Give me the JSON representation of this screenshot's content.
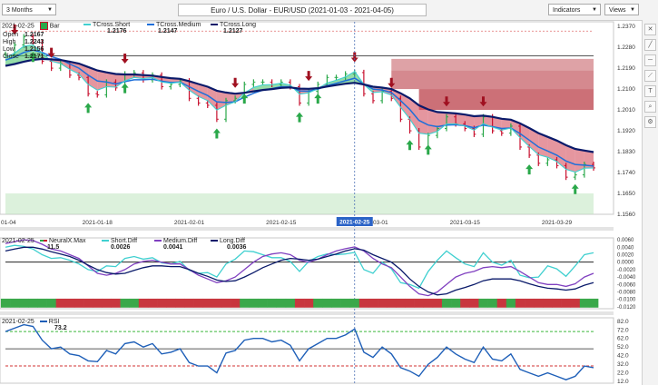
{
  "toolbar": {
    "period": "3 Months",
    "title": "Euro / U.S. Dollar - EUR/USD (2021-01-03 - 2021-04-05)",
    "indicators_label": "Indicators",
    "views_label": "Views"
  },
  "price_legend": {
    "date": "2021-02-25",
    "bar_label": "Bar",
    "open_label": "Open",
    "open": "1.2167",
    "high_label": "High",
    "high": "1.2243",
    "low_label": "Low",
    "low": "1.2156",
    "close_label": "Close",
    "close": "1.2171",
    "short_label": "TCross.Short",
    "short": "1.2176",
    "medium_label": "TCross.Medium",
    "medium": "1.2147",
    "long_label": "TCross.Long",
    "long": "1.2127"
  },
  "diff_legend": {
    "date": "2021-02-25",
    "neural_label": "NeuralX.Max",
    "neural": "11.5",
    "short_label": "Short.Diff",
    "short": "0.0026",
    "medium_label": "Medium.Diff",
    "medium": "0.0041",
    "long_label": "Long.Diff",
    "long": "0.0036"
  },
  "rsi_legend": {
    "date": "2021-02-25",
    "label": "RSI",
    "value": "73.2"
  },
  "x_axis": {
    "labels": [
      "01-04",
      "2021-01-18",
      "2021-02-01",
      "2021-02-15",
      "2021-03-01",
      "2021-03-15",
      "2021-03-29"
    ],
    "cursor_label": "2021-02-25"
  },
  "price_axis": [
    "1.2370",
    "1.2280",
    "1.2190",
    "1.2100",
    "1.2010",
    "1.1920",
    "1.1830",
    "1.1740",
    "1.1650",
    "1.1560"
  ],
  "diff_axis": [
    "0.0060",
    "0.0040",
    "0.0020",
    "0.0000",
    "-0.0020",
    "-0.0040",
    "-0.0060",
    "-0.0080",
    "-0.0100",
    "-0.0120"
  ],
  "rsi_axis": [
    "82.0",
    "72.0",
    "62.0",
    "52.0",
    "42.0",
    "32.0",
    "22.0",
    "12.0"
  ],
  "colors": {
    "short": "#40d0d0",
    "medium": "#8040c0",
    "long": "#0a1a6a",
    "tcross_blue": "#1e6fd9",
    "up": "#2aa84a",
    "down": "#c8102e",
    "rsi": "#1e5fb8",
    "zone": "#b5303a",
    "green_zone": "#bfe6bf"
  },
  "chart_data": {
    "type": "line",
    "dates": [
      "2021-01-04",
      "2021-01-05",
      "2021-01-06",
      "2021-01-07",
      "2021-01-08",
      "2021-01-11",
      "2021-01-12",
      "2021-01-13",
      "2021-01-14",
      "2021-01-15",
      "2021-01-18",
      "2021-01-19",
      "2021-01-20",
      "2021-01-21",
      "2021-01-22",
      "2021-01-25",
      "2021-01-26",
      "2021-01-27",
      "2021-01-28",
      "2021-01-29",
      "2021-02-01",
      "2021-02-02",
      "2021-02-03",
      "2021-02-04",
      "2021-02-05",
      "2021-02-08",
      "2021-02-09",
      "2021-02-10",
      "2021-02-11",
      "2021-02-12",
      "2021-02-15",
      "2021-02-16",
      "2021-02-17",
      "2021-02-18",
      "2021-02-19",
      "2021-02-22",
      "2021-02-23",
      "2021-02-24",
      "2021-02-25",
      "2021-02-26",
      "2021-03-01",
      "2021-03-02",
      "2021-03-03",
      "2021-03-04",
      "2021-03-05",
      "2021-03-08",
      "2021-03-09",
      "2021-03-10",
      "2021-03-11",
      "2021-03-12",
      "2021-03-15",
      "2021-03-16",
      "2021-03-17",
      "2021-03-18",
      "2021-03-19",
      "2021-03-22",
      "2021-03-23",
      "2021-03-24",
      "2021-03-25",
      "2021-03-26",
      "2021-03-29",
      "2021-03-30",
      "2021-03-31",
      "2021-04-01",
      "2021-04-02"
    ],
    "close": [
      1.225,
      1.229,
      1.2325,
      1.23,
      1.222,
      1.219,
      1.221,
      1.216,
      1.215,
      1.208,
      1.2075,
      1.213,
      1.2105,
      1.2165,
      1.217,
      1.214,
      1.216,
      1.211,
      1.212,
      1.2135,
      1.206,
      1.204,
      1.203,
      1.197,
      1.205,
      1.206,
      1.212,
      1.213,
      1.213,
      1.212,
      1.213,
      1.211,
      1.204,
      1.209,
      1.212,
      1.215,
      1.215,
      1.2165,
      1.2171,
      1.208,
      1.205,
      1.209,
      1.206,
      1.197,
      1.192,
      1.185,
      1.19,
      1.193,
      1.198,
      1.195,
      1.193,
      1.1905,
      1.198,
      1.192,
      1.191,
      1.194,
      1.185,
      1.1815,
      1.178,
      1.1795,
      1.177,
      1.172,
      1.173,
      1.1775,
      1.176
    ],
    "short_series": [
      1.2235,
      1.2255,
      1.2285,
      1.229,
      1.2255,
      1.222,
      1.221,
      1.2185,
      1.2165,
      1.212,
      1.2095,
      1.211,
      1.2108,
      1.2135,
      1.215,
      1.2145,
      1.215,
      1.213,
      1.2125,
      1.213,
      1.2095,
      1.2068,
      1.205,
      1.201,
      1.203,
      1.2045,
      1.2083,
      1.2107,
      1.2118,
      1.2119,
      1.2125,
      1.2117,
      1.2078,
      1.2084,
      1.2102,
      1.2126,
      1.2138,
      1.2152,
      1.2176,
      1.212,
      1.2085,
      1.2088,
      1.2074,
      1.2022,
      1.1971,
      1.191,
      1.1905,
      1.1918,
      1.1949,
      1.195,
      1.194,
      1.1923,
      1.1951,
      1.1936,
      1.1923,
      1.1932,
      1.1891,
      1.1853,
      1.1817,
      1.1806,
      1.1788,
      1.1754,
      1.1742,
      1.1759,
      1.176
    ],
    "medium_series": [
      1.2225,
      1.2238,
      1.2258,
      1.2268,
      1.2258,
      1.224,
      1.2228,
      1.2208,
      1.219,
      1.216,
      1.2135,
      1.213,
      1.2122,
      1.2132,
      1.214,
      1.214,
      1.2142,
      1.2134,
      1.2128,
      1.213,
      1.211,
      1.209,
      1.2072,
      1.2045,
      1.2042,
      1.2045,
      1.2065,
      1.2082,
      1.2095,
      1.2102,
      1.211,
      1.211,
      1.2092,
      1.2091,
      1.21,
      1.2115,
      1.2125,
      1.2136,
      1.2147,
      1.2122,
      1.21,
      1.2096,
      1.2085,
      1.205,
      1.2012,
      1.1965,
      1.1945,
      1.1938,
      1.1945,
      1.1946,
      1.1942,
      1.1933,
      1.1945,
      1.1938,
      1.193,
      1.1932,
      1.1908,
      1.188,
      1.185,
      1.1833,
      1.1815,
      1.179,
      1.1775,
      1.1772,
      1.1768
    ],
    "long_series": [
      1.22,
      1.2208,
      1.2218,
      1.2226,
      1.223,
      1.2228,
      1.2225,
      1.2218,
      1.221,
      1.2195,
      1.218,
      1.2172,
      1.2165,
      1.2163,
      1.2163,
      1.216,
      1.2158,
      1.2152,
      1.2147,
      1.2144,
      1.2134,
      1.2122,
      1.211,
      1.2093,
      1.2085,
      1.208,
      1.2084,
      1.209,
      1.2096,
      1.21,
      1.2105,
      1.2107,
      1.2102,
      1.2101,
      1.2104,
      1.2111,
      1.2117,
      1.2123,
      1.2127,
      1.212,
      1.211,
      1.2106,
      1.21,
      1.2082,
      1.206,
      1.203,
      1.2012,
      1.2001,
      1.1998,
      1.1995,
      1.199,
      1.1983,
      1.1985,
      1.198,
      1.1972,
      1.1968,
      1.1952,
      1.1932,
      1.191,
      1.1894,
      1.1878,
      1.1858,
      1.1842,
      1.1835,
      1.1828
    ],
    "short_diff": [
      0.004,
      0.0045,
      0.0042,
      0.0035,
      0.002,
      0.001,
      0.0012,
      0.0005,
      -0.0005,
      -0.002,
      -0.0025,
      -0.001,
      -0.0012,
      0.001,
      0.0015,
      0.0008,
      0.0012,
      -0.0002,
      -0.0005,
      0.0002,
      -0.0022,
      -0.003,
      -0.0028,
      -0.004,
      -0.0005,
      0.0008,
      0.003,
      0.0028,
      0.002,
      0.0012,
      0.0012,
      0.0002,
      -0.0025,
      0.0002,
      0.0015,
      0.0022,
      0.002,
      0.0022,
      0.0026,
      -0.002,
      -0.003,
      0.0,
      -0.0018,
      -0.0055,
      -0.006,
      -0.007,
      -0.0025,
      0.0005,
      0.003,
      0.0012,
      -0.0005,
      -0.0012,
      0.0025,
      0.0,
      -0.0008,
      0.0005,
      -0.0035,
      -0.0042,
      -0.004,
      -0.001,
      -0.0018,
      -0.0038,
      -0.001,
      0.002,
      0.0025
    ],
    "medium_diff": [
      0.005,
      0.0055,
      0.006,
      0.0058,
      0.0048,
      0.0035,
      0.003,
      0.002,
      0.001,
      -0.001,
      -0.003,
      -0.0035,
      -0.003,
      -0.002,
      -0.0005,
      0.0002,
      0.0005,
      0.0,
      -0.0005,
      -0.0005,
      -0.002,
      -0.0035,
      -0.0045,
      -0.0055,
      -0.005,
      -0.004,
      -0.002,
      0.0,
      0.0015,
      0.0022,
      0.0025,
      0.002,
      0.0005,
      0.0,
      0.0008,
      0.002,
      0.003,
      0.0036,
      0.0041,
      0.003,
      0.001,
      -0.0005,
      -0.0015,
      -0.004,
      -0.0065,
      -0.0085,
      -0.009,
      -0.008,
      -0.006,
      -0.004,
      -0.003,
      -0.0025,
      -0.0015,
      -0.0012,
      -0.0015,
      -0.0012,
      -0.0025,
      -0.004,
      -0.0055,
      -0.006,
      -0.006,
      -0.0065,
      -0.0058,
      -0.004,
      -0.003
    ],
    "long_diff": [
      0.003,
      0.0035,
      0.004,
      0.004,
      0.0035,
      0.0028,
      0.0022,
      0.0015,
      0.0005,
      -0.0008,
      -0.002,
      -0.0028,
      -0.0032,
      -0.003,
      -0.0022,
      -0.0015,
      -0.001,
      -0.001,
      -0.0012,
      -0.0012,
      -0.002,
      -0.003,
      -0.0038,
      -0.0048,
      -0.0052,
      -0.005,
      -0.004,
      -0.0028,
      -0.0015,
      -0.0005,
      0.0005,
      0.001,
      0.0008,
      0.0005,
      0.0008,
      0.0015,
      0.0022,
      0.003,
      0.0036,
      0.0032,
      0.002,
      0.001,
      0.0,
      -0.002,
      -0.0045,
      -0.0065,
      -0.008,
      -0.0088,
      -0.0085,
      -0.0075,
      -0.0068,
      -0.006,
      -0.005,
      -0.0045,
      -0.0045,
      -0.0045,
      -0.005,
      -0.0058,
      -0.0065,
      -0.007,
      -0.0072,
      -0.0075,
      -0.0072,
      -0.0062,
      -0.0055
    ],
    "neural_signal": [
      1,
      1,
      1,
      1,
      1,
      1,
      -1,
      -1,
      -1,
      -1,
      -1,
      -1,
      -1,
      1,
      1,
      -1,
      -1,
      -1,
      -1,
      -1,
      -1,
      -1,
      -1,
      -1,
      -1,
      -1,
      1,
      1,
      1,
      1,
      1,
      1,
      -1,
      -1,
      1,
      1,
      1,
      1,
      1,
      -1,
      -1,
      -1,
      -1,
      -1,
      -1,
      -1,
      -1,
      -1,
      1,
      1,
      -1,
      -1,
      1,
      1,
      -1,
      1,
      -1,
      -1,
      -1,
      -1,
      -1,
      -1,
      -1,
      1,
      1
    ],
    "rsi": [
      70,
      74,
      78,
      76,
      60,
      50,
      52,
      44,
      42,
      36,
      35,
      48,
      44,
      56,
      58,
      52,
      56,
      44,
      46,
      50,
      34,
      30,
      30,
      22,
      45,
      48,
      60,
      62,
      62,
      58,
      60,
      54,
      36,
      50,
      56,
      62,
      62,
      66,
      73,
      46,
      40,
      52,
      44,
      28,
      24,
      18,
      32,
      40,
      52,
      44,
      38,
      34,
      52,
      38,
      36,
      44,
      26,
      22,
      18,
      22,
      18,
      14,
      18,
      30,
      28
    ],
    "buy_signals": [
      "2021-01-07",
      "2021-01-15",
      "2021-01-21",
      "2021-02-04",
      "2021-02-09",
      "2021-02-17",
      "2021-02-19",
      "2021-03-05",
      "2021-03-09",
      "2021-03-24",
      "2021-03-31"
    ],
    "sell_signals": [
      "2021-01-05",
      "2021-01-11",
      "2021-01-21",
      "2021-02-08",
      "2021-02-18",
      "2021-02-25",
      "2021-03-03",
      "2021-03-11",
      "2021-03-17"
    ],
    "price_range": [
      1.156,
      1.239
    ],
    "diff_range": [
      -0.0125,
      0.0065
    ],
    "rsi_range": [
      10,
      86
    ],
    "rsi_levels": [
      70,
      30
    ],
    "zones": [
      {
        "start": "2021-03-03",
        "end": "2021-04-02",
        "low": 1.218,
        "high": 1.223
      },
      {
        "start": "2021-03-03",
        "end": "2021-04-02",
        "low": 1.21,
        "high": 1.218
      },
      {
        "start": "2021-03-08",
        "end": "2021-04-02",
        "low": 1.201,
        "high": 1.21
      }
    ],
    "green_zone": {
      "start": "2021-01-04",
      "end": "2021-04-02",
      "low": 1.156,
      "high": 1.165
    }
  }
}
